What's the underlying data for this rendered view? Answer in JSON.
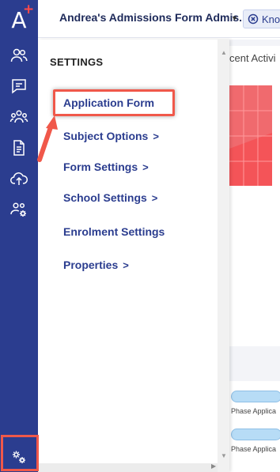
{
  "app": {
    "logo_letter": "A",
    "logo_plus": "+",
    "brand_color": "#2b3d8f",
    "accent_color": "#ff4a4a"
  },
  "header": {
    "title": "Andrea's Admissions Form Admis...",
    "caret_icon": "caret-down-icon",
    "know_button_label": "Kno",
    "know_icon": "x-circle-icon"
  },
  "rail": {
    "items": [
      {
        "name": "contacts",
        "icon": "people-icon"
      },
      {
        "name": "messages",
        "icon": "chat-icon"
      },
      {
        "name": "groups",
        "icon": "group-icon"
      },
      {
        "name": "documents",
        "icon": "document-icon"
      },
      {
        "name": "upload",
        "icon": "cloud-upload-icon"
      },
      {
        "name": "user-settings",
        "icon": "users-gear-icon"
      },
      {
        "name": "settings",
        "icon": "gears-icon"
      }
    ]
  },
  "settings_menu": {
    "heading": "SETTINGS",
    "items": [
      {
        "label": "Application Form",
        "has_submenu": false
      },
      {
        "label": "Subject Options",
        "has_submenu": true
      },
      {
        "label": "Form Settings",
        "has_submenu": true
      },
      {
        "label": "School Settings",
        "has_submenu": true
      },
      {
        "label": "Enrolment Settings",
        "has_submenu": false
      },
      {
        "label": "Properties",
        "has_submenu": true
      }
    ],
    "chevron": ">"
  },
  "background": {
    "recent_title": "cent Activi",
    "phase_label_1": "Phase Applica",
    "phase_label_2": "Phase Applica"
  },
  "annotations": {
    "highlight_color": "#f0584a"
  }
}
